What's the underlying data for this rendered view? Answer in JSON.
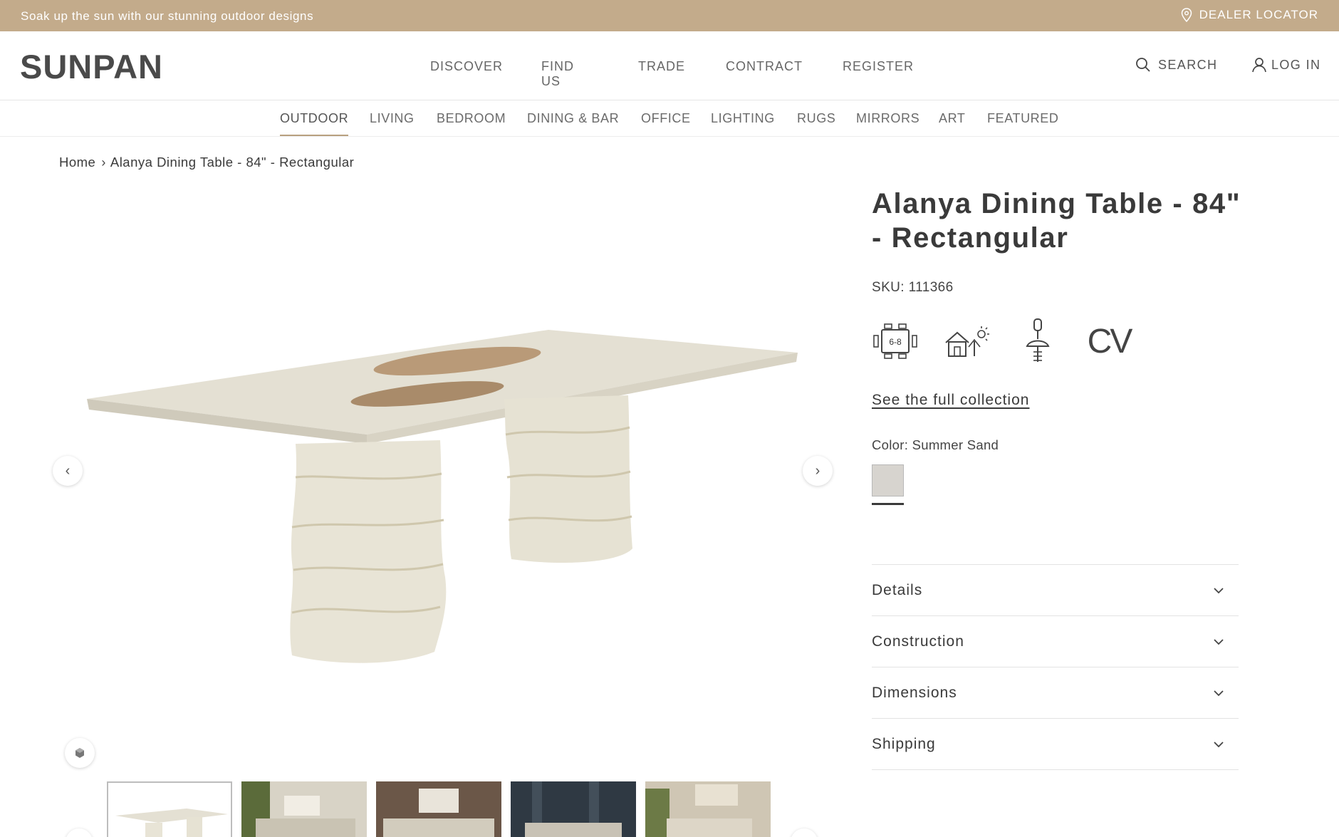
{
  "announcement": {
    "text": "Soak up the sun with our stunning outdoor designs",
    "dealer_label": "DEALER LOCATOR"
  },
  "header": {
    "logo": "SUNPAN",
    "nav": [
      "DISCOVER",
      "FIND US",
      "TRADE",
      "CONTRACT",
      "REGISTER"
    ],
    "search_label": "SEARCH",
    "login_label": "LOG IN"
  },
  "categories": {
    "items": [
      "OUTDOOR",
      "LIVING",
      "BEDROOM",
      "DINING & BAR",
      "OFFICE",
      "LIGHTING",
      "RUGS",
      "MIRRORS",
      "ART",
      "FEATURED"
    ],
    "active": "OUTDOOR"
  },
  "breadcrumb": {
    "home": "Home",
    "current": "Alanya Dining Table - 84\" - Rectangular"
  },
  "product": {
    "title": "Alanya Dining Table - 84\" - Rectangular",
    "sku": "SKU: 111366",
    "badges": [
      "6-8",
      "outdoor-icon",
      "lamp-icon",
      "CV"
    ],
    "collection_link": "See the full collection",
    "color_label": "Color: Summer Sand",
    "swatch_color": "#d7d4cf"
  },
  "accordion": [
    "Details",
    "Construction",
    "Dimensions",
    "Shipping"
  ],
  "colors": {
    "announcement_bg": "#c3ab8b",
    "accent_underline": "#b8a07f",
    "text": "#3a3a3a"
  }
}
